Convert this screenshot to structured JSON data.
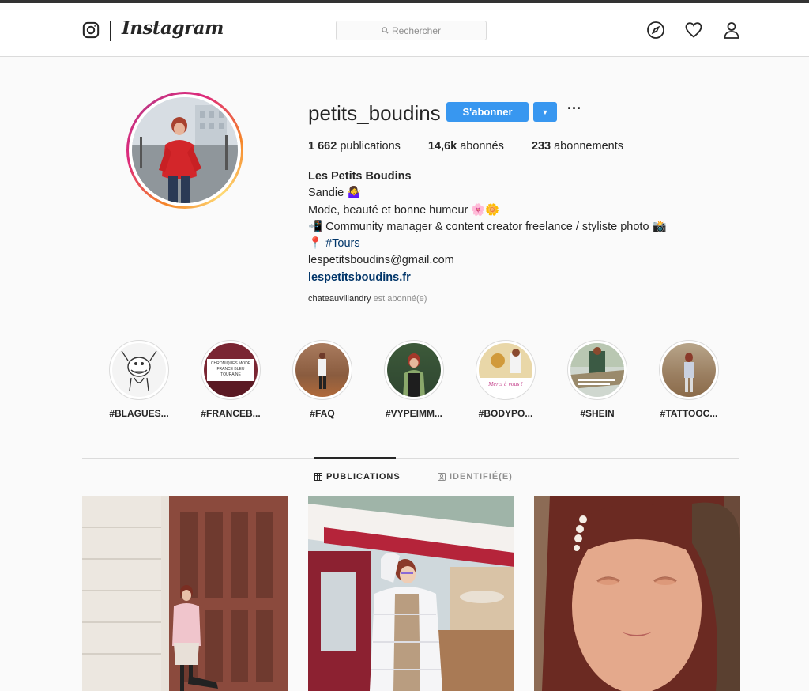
{
  "header": {
    "brand": "Instagram",
    "search_placeholder": "Rechercher"
  },
  "profile": {
    "username": "petits_boudins",
    "follow_label": "S'abonner",
    "dropdown_glyph": "▼",
    "more_glyph": "···",
    "stats": {
      "posts_value": "1 662",
      "posts_label": "publications",
      "followers_value": "14,6k",
      "followers_label": "abonnés",
      "following_value": "233",
      "following_label": "abonnements"
    },
    "bio": {
      "full_name": "Les Petits Boudins",
      "line1": "Sandie 🤷‍♀️",
      "line2": "Mode, beauté et bonne humeur 🌸🌼",
      "line3": "📲 Community manager & content creator freelance / styliste photo 📸",
      "line4_pin": "📍",
      "line4_tag": "#Tours",
      "email": "lespetitsboudins@gmail.com",
      "website": "lespetitsboudins.fr"
    },
    "followed_by_user": "chateauvillandry",
    "followed_by_suffix": "est abonné(e)"
  },
  "highlights": [
    {
      "label": "#BLAGUES..."
    },
    {
      "label": "#FRANCEB..."
    },
    {
      "label": "#FAQ"
    },
    {
      "label": "#VYPEIMM..."
    },
    {
      "label": "#BODYPO..."
    },
    {
      "label": "#SHEIN"
    },
    {
      "label": "#TATTOOC..."
    }
  ],
  "highlight_texts": {
    "chroniques": "CHRONIQUES MODE",
    "chroniques_sub": "FRANCE BLEU TOURAINE",
    "merci": "Merci à vous !"
  },
  "tabs": {
    "publications": "PUBLICATIONS",
    "identifie": "IDENTIFIÉ(E)"
  },
  "colors": {
    "accent": "#3897f0",
    "link": "#003569",
    "border": "#dbdbdb"
  },
  "icons": [
    "instagram-logo-icon",
    "search-icon",
    "explore-compass-icon",
    "heart-icon",
    "profile-user-icon",
    "grid-icon",
    "tagged-icon"
  ]
}
